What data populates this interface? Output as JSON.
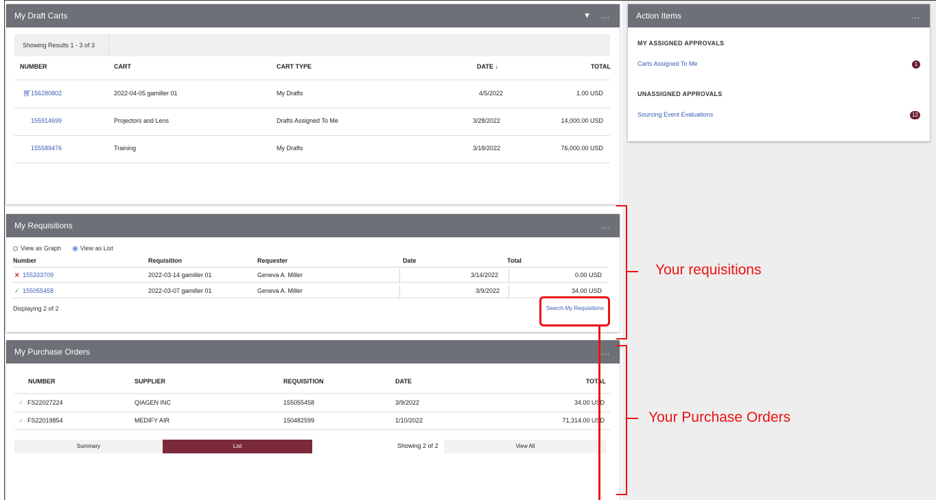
{
  "draft_carts": {
    "title": "My Draft Carts",
    "menu": "...",
    "results_text": "Showing Results 1 - 3 of 3",
    "columns": {
      "number": "NUMBER",
      "cart": "CART",
      "cart_type": "CART TYPE",
      "date": "DATE ↓",
      "total": "TOTAL"
    },
    "rows": [
      {
        "number": "156280802",
        "cart": "2022-04-05 gamiller 01",
        "type": "My Drafts",
        "date": "4/5/2022",
        "total": "1.00 USD"
      },
      {
        "number": "155914699",
        "cart": "Projectors and Lens",
        "type": "Drafts Assigned To Me",
        "date": "3/28/2022",
        "total": "14,000.00 USD"
      },
      {
        "number": "155589476",
        "cart": "Training",
        "type": "My Drafts",
        "date": "3/18/2022",
        "total": "76,000.00 USD"
      }
    ]
  },
  "action_items": {
    "title": "Action Items",
    "menu": "...",
    "assigned_title": "MY ASSIGNED APPROVALS",
    "assigned_link": "Carts Assigned To Me",
    "assigned_count": "1",
    "unassigned_title": "UNASSIGNED APPROVALS",
    "unassigned_link": "Sourcing Event Evaluations",
    "unassigned_count": "12"
  },
  "requisitions": {
    "title": "My Requisitions",
    "menu": "...",
    "view_graph": "View as Graph",
    "view_list": "View as List",
    "columns": {
      "number": "Number",
      "requisition": "Requisition",
      "requester": "Requester",
      "date": "Date",
      "total": "Total"
    },
    "rows": [
      {
        "number": "155333709",
        "requisition": "2022-03-14 gamiller 01",
        "requester": "Geneva A. Miller",
        "date": "3/14/2022",
        "total": "0.00 USD"
      },
      {
        "number": "155055458",
        "requisition": "2022-03-07 gamiller 01",
        "requester": "Geneva A. Miller",
        "date": "3/9/2022",
        "total": "34.00 USD"
      }
    ],
    "displaying": "Displaying 2 of 2",
    "search_link": "Search My Requisitions"
  },
  "purchase_orders": {
    "title": "My Purchase Orders",
    "menu": "...",
    "columns": {
      "number": "NUMBER",
      "supplier": "SUPPLIER",
      "requisition": "REQUISITION",
      "date": "DATE",
      "total": "TOTAL"
    },
    "rows": [
      {
        "number": "FS22027224",
        "supplier": "QIAGEN INC",
        "requisition": "155055458",
        "date": "3/9/2022",
        "total": "34.00 USD"
      },
      {
        "number": "FS22019854",
        "supplier": "MEDIFY AIR",
        "requisition": "150482599",
        "date": "1/10/2022",
        "total": "71,314.00 USD"
      }
    ],
    "summary_label": "Summary",
    "list_label": "List",
    "showing": "Showing 2 of 2",
    "view_all": "View All"
  },
  "annotations": {
    "requisitions_label": "Your requisitions",
    "purchase_orders_label": "Your Purchase Orders"
  },
  "colors": {
    "header_bg": "#6e7078",
    "accent_maroon": "#7b2a3b",
    "link_blue": "#3b5bb5",
    "annotation_red": "#ee1111"
  }
}
